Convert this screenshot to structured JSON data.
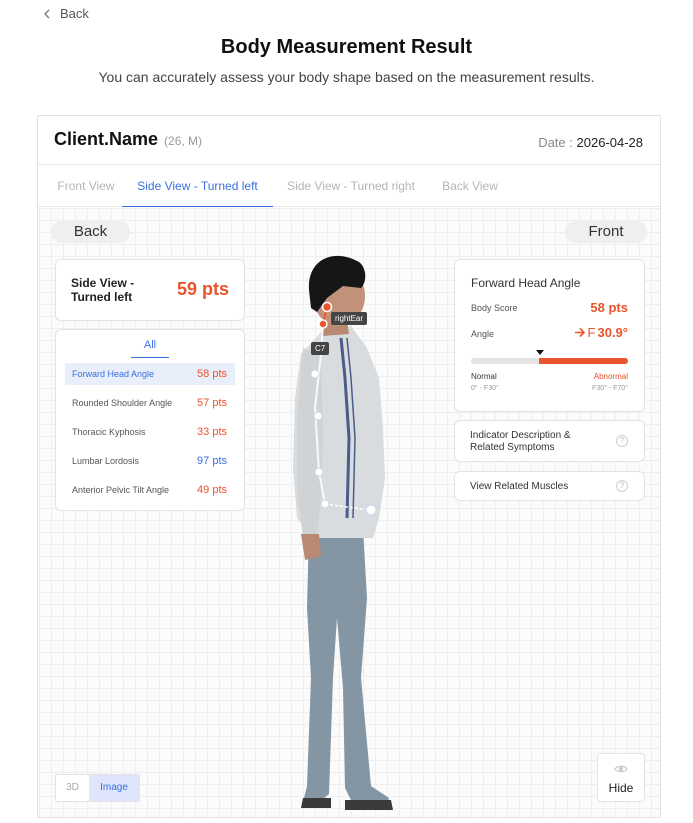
{
  "nav": {
    "back_label": "Back"
  },
  "header": {
    "title": "Body Measurement Result",
    "subtitle": "You can accurately assess your body shape based on the measurement results."
  },
  "client": {
    "name": "Client.Name",
    "meta": "(26, M)",
    "date_label": "Date :",
    "date_value": "2026-04-28"
  },
  "tabs": [
    {
      "label": "Front View",
      "active": false
    },
    {
      "label": "Side View - Turned left",
      "active": true
    },
    {
      "label": "Side View - Turned right",
      "active": false
    },
    {
      "label": "Back View",
      "active": false
    }
  ],
  "view_buttons": {
    "back": "Back",
    "front": "Front"
  },
  "score_card": {
    "label": "Side View - Turned left",
    "value": "59 pts"
  },
  "indicator_list": {
    "tab": "All",
    "items": [
      {
        "label": "Forward Head Angle",
        "value": "58 pts",
        "status": "bad",
        "active": true
      },
      {
        "label": "Rounded Shoulder Angle",
        "value": "57 pts",
        "status": "bad",
        "active": false
      },
      {
        "label": "Thoracic Kyphosis",
        "value": "33 pts",
        "status": "bad",
        "active": false
      },
      {
        "label": "Lumbar Lordosis",
        "value": "97 pts",
        "status": "good",
        "active": false
      },
      {
        "label": "Anterior Pelvic Tilt Angle",
        "value": "49 pts",
        "status": "bad",
        "active": false
      }
    ]
  },
  "detail": {
    "title": "Forward Head Angle",
    "body_score_label": "Body Score",
    "body_score_value": "58 pts",
    "angle_label": "Angle",
    "angle_direction": "F",
    "angle_value": "30.9°",
    "scale": {
      "normal_label": "Normal",
      "normal_range": "0° - F30°",
      "abnormal_label": "Abnormal",
      "abnormal_range": "F30° - F70°",
      "abnormal_fraction": 0.57,
      "marker_fraction": 0.44
    }
  },
  "info_buttons": {
    "description": "Indicator Description & Related Symptoms",
    "muscles": "View Related Muscles"
  },
  "figure_labels": {
    "ear": "rightEar",
    "c7": "C7"
  },
  "mode_toggle": {
    "options": [
      "3D",
      "Image"
    ],
    "active": "Image"
  },
  "hide_button": {
    "label": "Hide"
  },
  "colors": {
    "accent": "#3a6fe0",
    "alert": "#e8542c",
    "good": "#3a6fe0"
  },
  "icons": [
    "chevron-left-icon",
    "arrow-right-icon",
    "question-icon",
    "eye-icon"
  ]
}
